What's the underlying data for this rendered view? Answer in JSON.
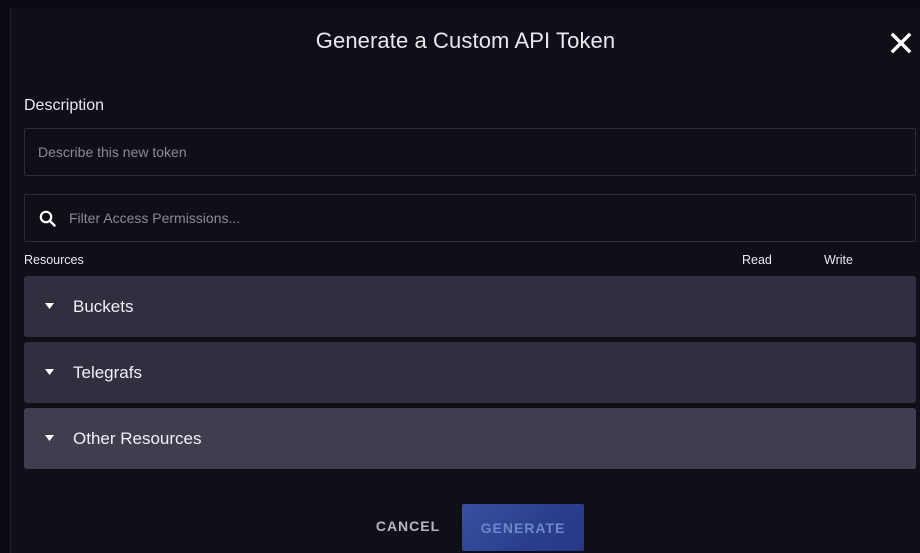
{
  "modal": {
    "title": "Generate a Custom API Token"
  },
  "description": {
    "label": "Description",
    "value": "",
    "placeholder": "Describe this new token"
  },
  "filter": {
    "value": "",
    "placeholder": "Filter Access Permissions..."
  },
  "table": {
    "headers": {
      "resources": "Resources",
      "read": "Read",
      "write": "Write"
    },
    "rows": [
      {
        "label": "Buckets",
        "icon": "caret-down-icon"
      },
      {
        "label": "Telegrafs",
        "icon": "caret-down-icon"
      },
      {
        "label": "Other Resources",
        "icon": "caret-down-icon"
      }
    ]
  },
  "footer": {
    "cancel_label": "CANCEL",
    "generate_label": "GENERATE",
    "generate_disabled": true
  },
  "colors": {
    "background": "#0f0f17",
    "row": "#2f2f3f",
    "row_hover": "#3e3e4f",
    "primary": "#2a3f8c"
  }
}
